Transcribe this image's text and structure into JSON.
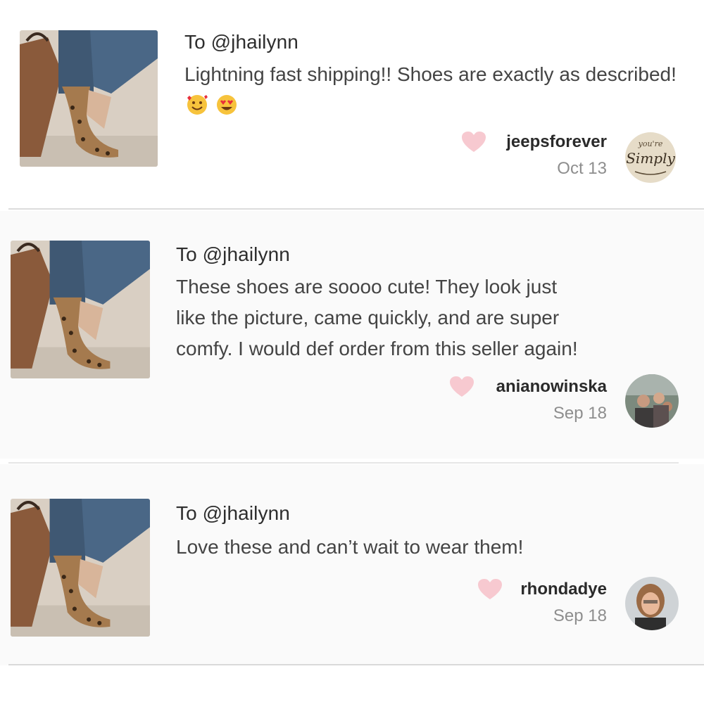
{
  "reviews": [
    {
      "to": "To @jhailynn",
      "text": "Lightning fast shipping!! Shoes are exactly as described!",
      "emojis": [
        "smiling-face-with-hearts",
        "heart-eyes"
      ],
      "username": "jeepsforever",
      "date": "Oct 13",
      "avatar_text": "you're simply"
    },
    {
      "to": "To @jhailynn",
      "text_lines": [
        "These shoes are soooo cute! They look just",
        "like the picture, came quickly, and are super",
        "comfy. I would def order from this seller again!"
      ],
      "username": "anianowinska",
      "date": "Sep 18"
    },
    {
      "to": "To @jhailynn",
      "text": "Love these and can’t wait to wear them!",
      "username": "rhondadye",
      "date": "Sep 18"
    }
  ],
  "colors": {
    "heart": "#f7c9d0",
    "divider": "#e6e6e6",
    "card_bg": "#fafafa"
  },
  "icons": {
    "like": "heart-icon"
  }
}
